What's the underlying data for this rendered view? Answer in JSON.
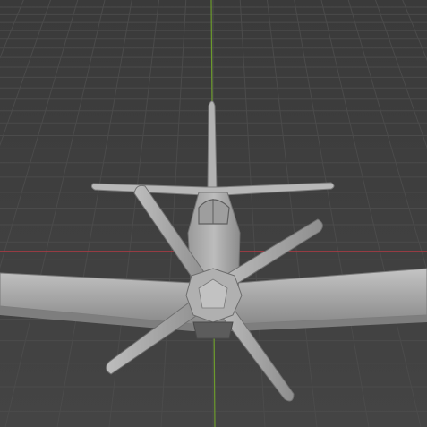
{
  "viewport": {
    "background": "#3d3d3d",
    "grid_color": "#4a4a4a",
    "axis_x_color": "#c43a45",
    "axis_y_color": "#6e9c2e"
  },
  "model": {
    "icon": "airplane-model",
    "surface_color": "#a8a8a8",
    "shadow_color": "#6f6f6f",
    "highlight_color": "#c9c9c9"
  }
}
